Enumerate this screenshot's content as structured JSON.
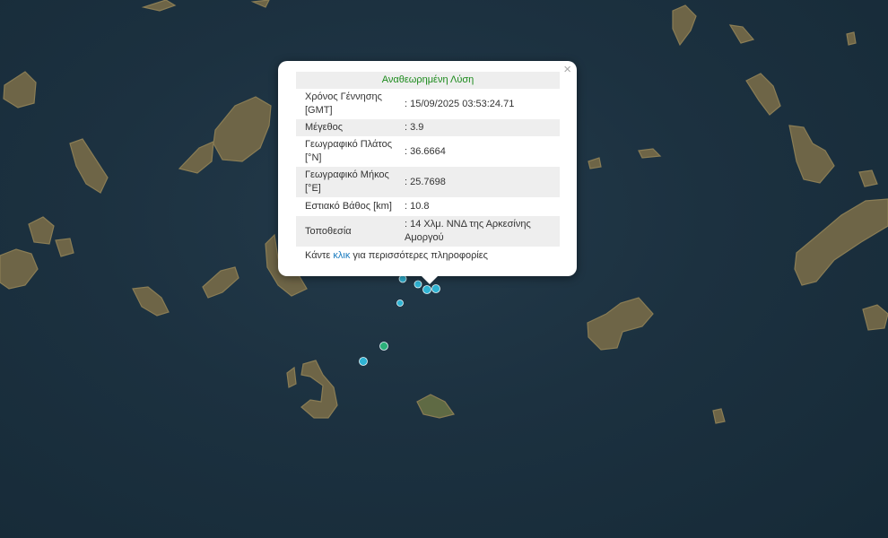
{
  "map": {
    "background": "#1c3140",
    "land_color": "#6e6547",
    "markers": [
      {
        "color": "#2fb3d3",
        "label": "recent-quake"
      },
      {
        "color": "#2fb3d3",
        "label": "recent-quake"
      },
      {
        "color": "#2fb3d3",
        "label": "recent-quake"
      },
      {
        "color": "#2fb3d3",
        "label": "recent-quake"
      },
      {
        "color": "#2fb3d3",
        "label": "recent-quake"
      },
      {
        "color": "#2fb3d3",
        "label": "recent-quake"
      },
      {
        "color": "#2bb07a",
        "label": "older-quake"
      }
    ]
  },
  "popup": {
    "close_glyph": "×",
    "title": "Αναθεωρημένη Λύση",
    "title_color": "#1b8a1b",
    "rows": [
      {
        "label": "Χρόνος Γέννησης [GMT]",
        "value": ": 15/09/2025 03:53:24.71"
      },
      {
        "label": "Μέγεθος",
        "value": ": 3.9"
      },
      {
        "label": "Γεωγραφικό Πλάτος [°N]",
        "value": ": 36.6664"
      },
      {
        "label": "Γεωγραφικό Μήκος [°E]",
        "value": ": 25.7698"
      },
      {
        "label": "Εστιακό Βάθος [km]",
        "value": ": 10.8"
      },
      {
        "label": "Τοποθεσία",
        "value": ": 14 Χλμ. ΝΝΔ της Αρκεσίνης Αμοργού"
      }
    ],
    "footer_pre": "Κάντε ",
    "footer_link": "κλικ",
    "footer_post": " για περισσότερες πληροφορίες",
    "link_color": "#1a7bbf"
  }
}
